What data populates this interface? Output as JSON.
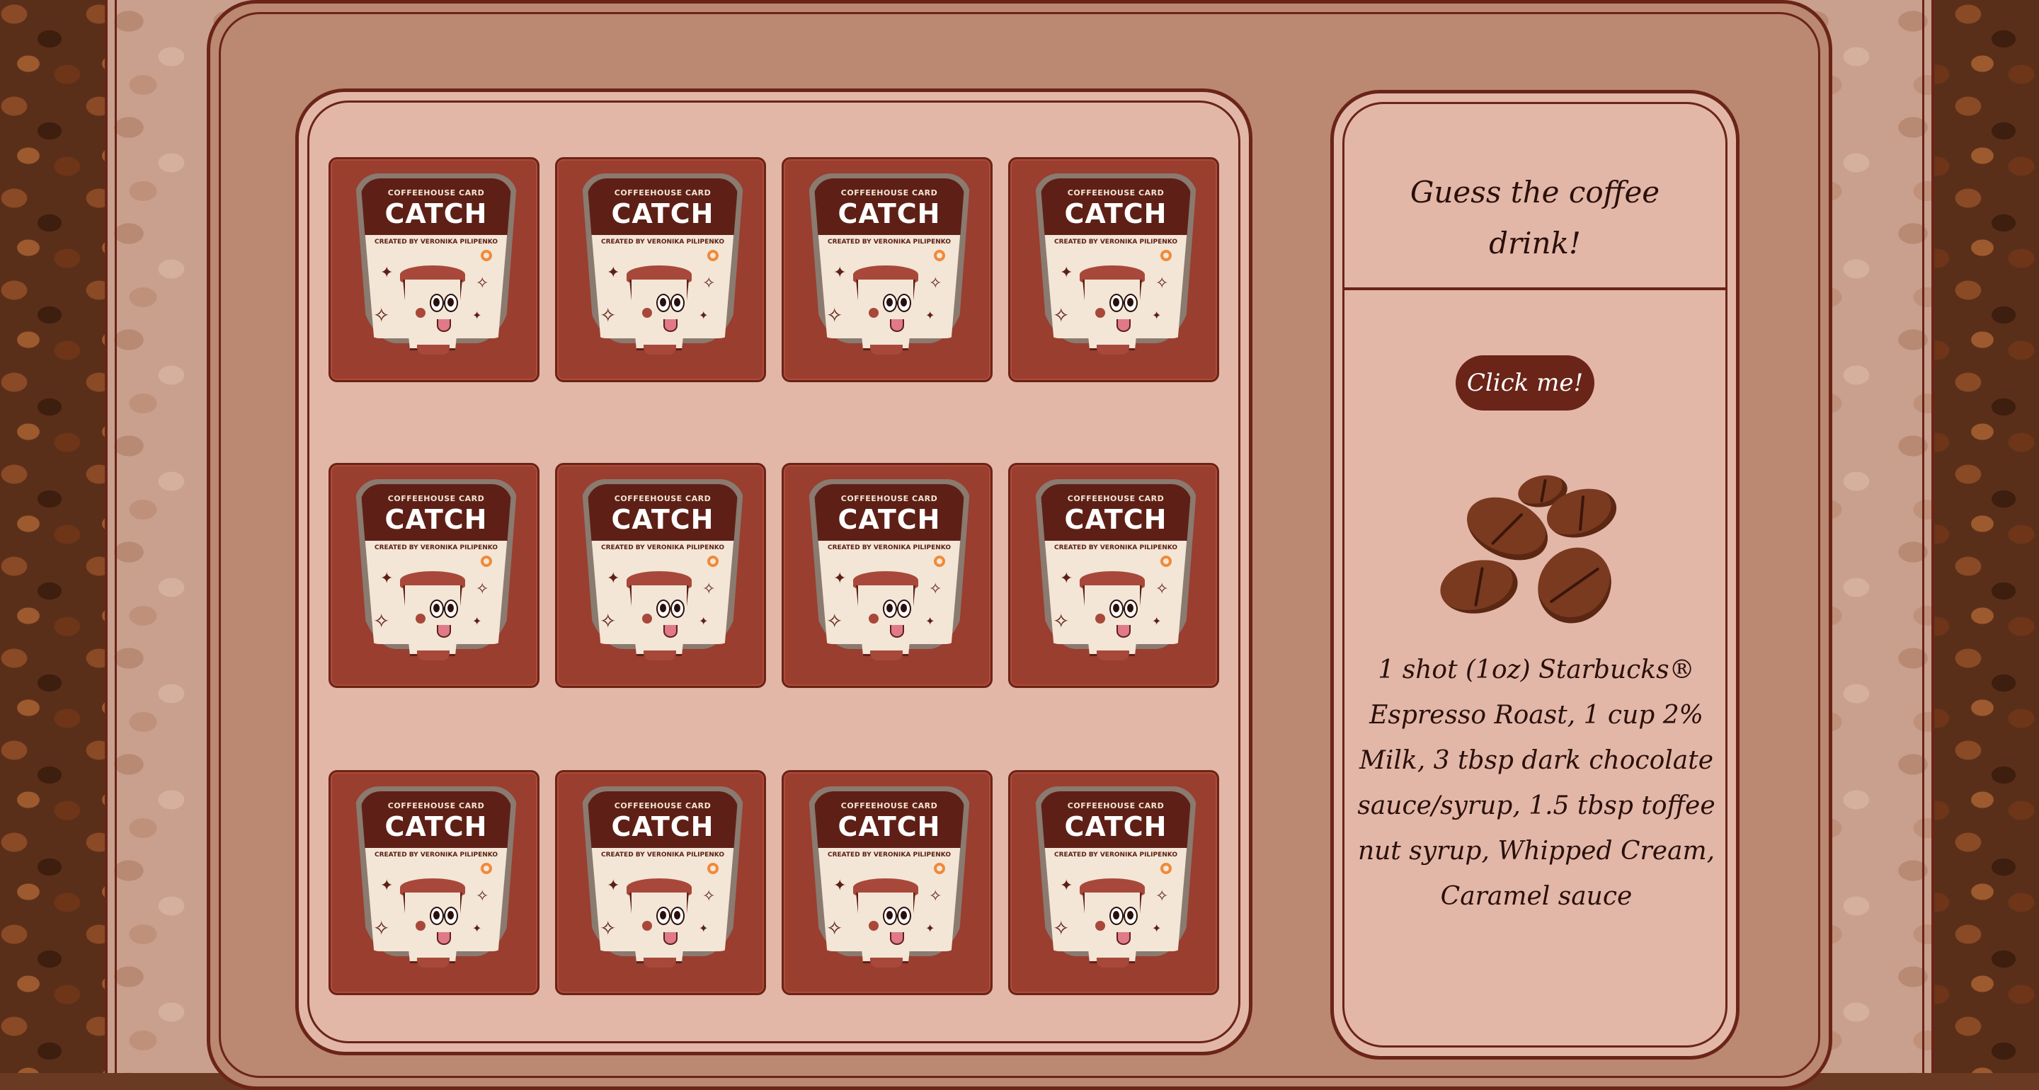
{
  "cards": [
    {
      "id": 1
    },
    {
      "id": 2
    },
    {
      "id": 3
    },
    {
      "id": 4
    },
    {
      "id": 5
    },
    {
      "id": 6
    },
    {
      "id": 7
    },
    {
      "id": 8
    },
    {
      "id": 9
    },
    {
      "id": 10
    },
    {
      "id": 11
    },
    {
      "id": 12
    }
  ],
  "card_face": {
    "top_label": "COFFEEHOUSE CARD",
    "title": "CATCH",
    "credit": "CREATED BY VERONIKA PILIPENKO"
  },
  "side_panel": {
    "prompt": "Guess the coffee drink!",
    "button_label": "Click me!",
    "answer": "1 shot (1oz) Starbucks® Espresso Roast, 1 cup 2% Milk, 3 tbsp dark chocolate sauce/syrup, 1.5 tbsp toffee nut syrup, Whipped Cream, Caramel sauce"
  },
  "colors": {
    "card_bg": "#9a3e2f",
    "border": "#6a2418",
    "panel_bg": "#e2b7a8",
    "frame_bg": "#bb8872"
  }
}
